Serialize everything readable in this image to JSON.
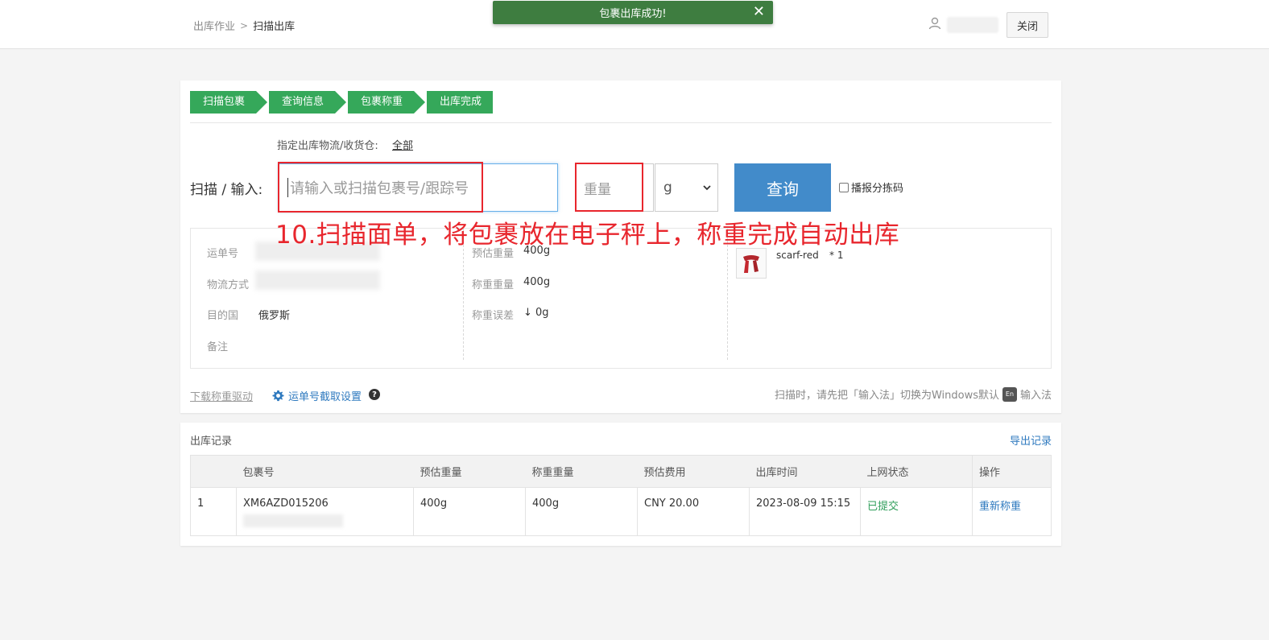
{
  "header": {
    "breadcrumb": [
      "出库作业",
      "扫描出库"
    ],
    "breadcrumb_sep": ">",
    "close_label": "关闭"
  },
  "toast": {
    "message": "包裹出库成功!",
    "close": "✕"
  },
  "steps": [
    "扫描包裹",
    "查询信息",
    "包裹称重",
    "出库完成"
  ],
  "target": {
    "label": "指定出库物流/收货仓:",
    "value": "全部"
  },
  "scan": {
    "label": "扫描 / 输入:",
    "placeholder": "请输入或扫描包裹号/跟踪号",
    "weight_placeholder": "重量",
    "unit": "g",
    "query_label": "查询",
    "sort_code_label": "播报分拣码"
  },
  "annotation": "10.扫描面单，将包裹放在电子秤上，称重完成自动出库",
  "info": {
    "waybill_label": "运单号",
    "shipping_label": "物流方式",
    "dest_label": "目的国",
    "dest_value": "俄罗斯",
    "note_label": "备注",
    "est_weight_label": "预估重量",
    "est_weight_value": "400g",
    "actual_weight_label": "称重重量",
    "actual_weight_value": "400g",
    "diff_label": "称重误差",
    "diff_value": "↓ 0g",
    "item_name": "scarf-red",
    "item_qty": "* 1"
  },
  "footer": {
    "download_label": "下载称重驱动",
    "settings_label": "运单号截取设置",
    "help": "?",
    "ime_tip_before": "扫描时，请先把「输入法」切换为Windows默认",
    "ime_badge": "En",
    "ime_tip_after": "输入法"
  },
  "records": {
    "title": "出库记录",
    "export_label": "导出记录",
    "columns": [
      "",
      "包裹号",
      "预估重量",
      "称重重量",
      "预估费用",
      "出库时间",
      "上网状态",
      "操作"
    ],
    "rows": [
      {
        "index": "1",
        "package_no": "XM6AZD015206",
        "est_weight": "400g",
        "actual_weight": "400g",
        "est_fee": "CNY 20.00",
        "time": "2023-08-09 15:15",
        "status": "已提交",
        "action": "重新称重"
      }
    ]
  },
  "colors": {
    "step_green": "#35a85a",
    "toast_green": "#3e7d40",
    "primary_blue": "#428bca",
    "annotation_red": "#e8262d"
  }
}
